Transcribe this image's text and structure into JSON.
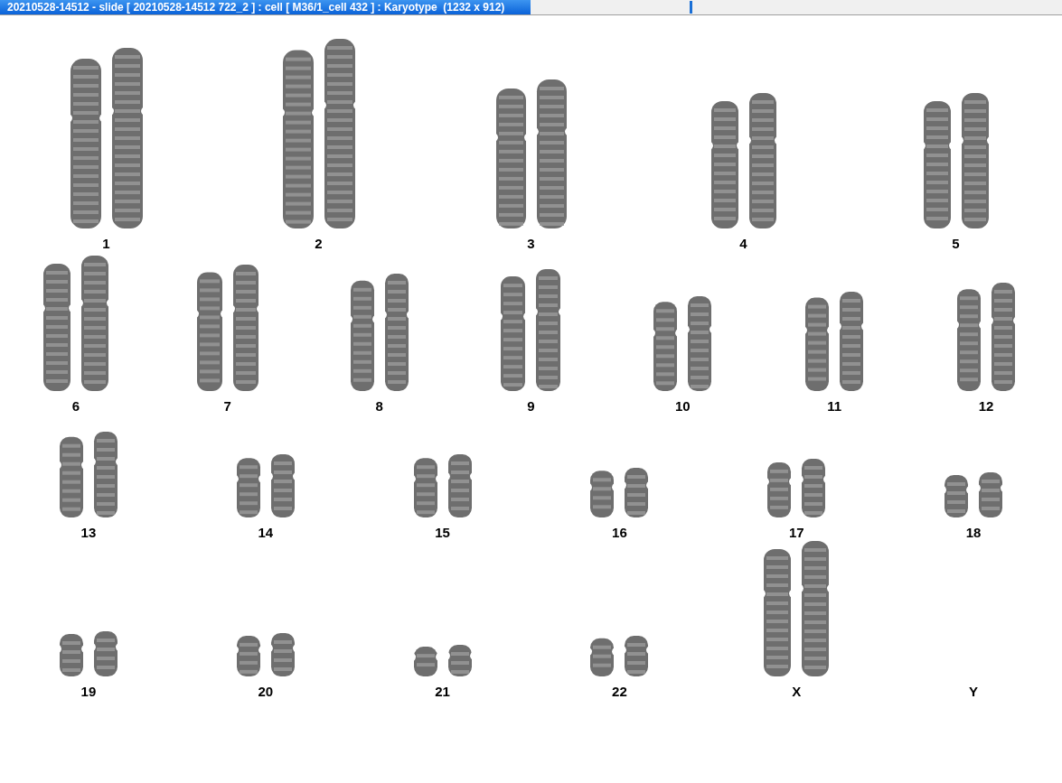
{
  "window": {
    "title": "20210528-14512 - slide [ 20210528-14512 722_2 ] : cell [ M36/1_cell 432 ] : Karyotype  (1232 x 912)"
  },
  "karyotype": {
    "rows": [
      [
        {
          "label": "1",
          "kind": "pair"
        },
        {
          "label": "2",
          "kind": "pair"
        },
        {
          "label": "3",
          "kind": "pair"
        },
        {
          "label": "4",
          "kind": "pair"
        },
        {
          "label": "5",
          "kind": "pair"
        }
      ],
      [
        {
          "label": "6",
          "kind": "pair"
        },
        {
          "label": "7",
          "kind": "pair"
        },
        {
          "label": "8",
          "kind": "pair"
        },
        {
          "label": "9",
          "kind": "pair"
        },
        {
          "label": "10",
          "kind": "pair"
        },
        {
          "label": "11",
          "kind": "pair"
        },
        {
          "label": "12",
          "kind": "pair"
        }
      ],
      [
        {
          "label": "13",
          "kind": "pair"
        },
        {
          "label": "14",
          "kind": "pair"
        },
        {
          "label": "15",
          "kind": "pair"
        },
        {
          "label": "16",
          "kind": "pair"
        },
        {
          "label": "17",
          "kind": "pair"
        },
        {
          "label": "18",
          "kind": "pair"
        }
      ],
      [
        {
          "label": "19",
          "kind": "pair"
        },
        {
          "label": "20",
          "kind": "pair"
        },
        {
          "label": "21",
          "kind": "pair"
        },
        {
          "label": "22",
          "kind": "pair"
        },
        {
          "label": "X",
          "kind": "pair"
        },
        {
          "label": "Y",
          "kind": "empty"
        }
      ]
    ]
  }
}
